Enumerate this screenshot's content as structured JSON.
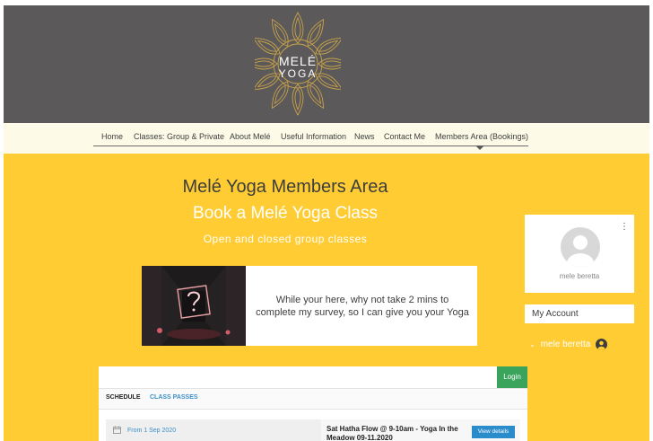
{
  "header": {
    "logo_line1": "MELÉ",
    "logo_line2": "YOGA"
  },
  "nav": {
    "items": [
      {
        "label": "Home"
      },
      {
        "label": "Classes: Group & Private"
      },
      {
        "label": "About Melé"
      },
      {
        "label": "Useful Information"
      },
      {
        "label": "News"
      },
      {
        "label": "Contact Me"
      },
      {
        "label": "Members Area (Bookings)"
      }
    ],
    "active_index": 6
  },
  "main": {
    "title": "Melé Yoga Members Area",
    "subtitle": "Book a Melé Yoga Class",
    "tagline": "Open and closed group classes",
    "survey_text": "While your here, why not take 2 mins to complete my survey, so I can give you your Yoga"
  },
  "profile": {
    "name": "mele beretta"
  },
  "account": {
    "my_account_label": "My Account",
    "user_label": "mele beretta"
  },
  "widget": {
    "login_label": "Login",
    "tabs": [
      {
        "label": "SCHEDULE"
      },
      {
        "label": "CLASS PASSES"
      }
    ],
    "date_label": "From 1 Sep 2020",
    "class_title": "Sat Hatha Flow @ 9-10am - Yoga In the Meadow 09-11.2020",
    "view_details_label": "View details"
  },
  "colors": {
    "header_bg": "#5b5959",
    "nav_bg": "#fdfbe8",
    "main_bg": "#ffcc33",
    "logo_gold": "#c9a24b",
    "login_green": "#3aa35c",
    "link_blue": "#3b8fc9"
  },
  "icons": {
    "logo": "mandala-logo",
    "profile": "user-avatar-icon",
    "menu": "kebab-menu-icon",
    "dropdown": "chevron-down-icon",
    "account": "user-circle-icon",
    "calendar": "calendar-icon"
  }
}
